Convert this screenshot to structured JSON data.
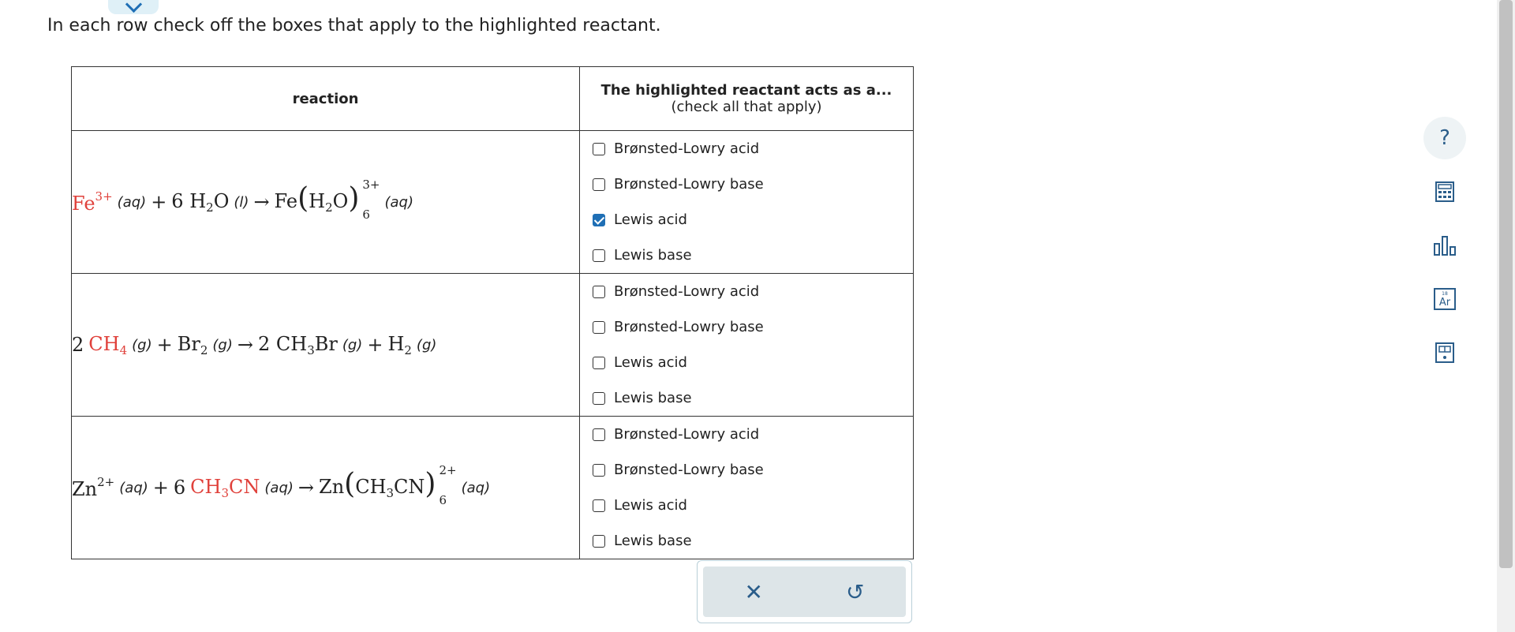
{
  "instruction": "In each row check off the boxes that apply to the highlighted reactant.",
  "table": {
    "col_reaction": "reaction",
    "col_role_title": "The highlighted reactant acts as a...",
    "col_role_subtitle": "(check all that apply)"
  },
  "rows": [
    {
      "equation": {
        "r1_symbol": "Fe",
        "r1_charge": "3+",
        "r1_state": "(aq)",
        "plus": "+",
        "coef": "6",
        "r2_a": "H",
        "r2_sub": "2",
        "r2_b": "O",
        "r2_state": "(l)",
        "arrow": "→",
        "p_metal": "Fe",
        "p_lparen": "(",
        "p_a": "H",
        "p_sub": "2",
        "p_b": "O",
        "p_rparen": ")",
        "p_charge": "3+",
        "p_count": "6",
        "p_state": "(aq)"
      },
      "options": [
        {
          "label": "Brønsted-Lowry acid",
          "checked": false
        },
        {
          "label": "Brønsted-Lowry base",
          "checked": false
        },
        {
          "label": "Lewis acid",
          "checked": true
        },
        {
          "label": "Lewis base",
          "checked": false
        }
      ]
    },
    {
      "equation": {
        "coef1": "2",
        "r1_a": "CH",
        "r1_sub": "4",
        "r1_state": "(g)",
        "plus1": "+",
        "r2_a": "Br",
        "r2_sub": "2",
        "r2_state": "(g)",
        "arrow": "→",
        "coef2": "2",
        "p1_a": "CH",
        "p1_sub": "3",
        "p1_b": "Br",
        "p1_state": "(g)",
        "plus2": "+",
        "p2_a": "H",
        "p2_sub": "2",
        "p2_state": "(g)"
      },
      "options": [
        {
          "label": "Brønsted-Lowry acid",
          "checked": false
        },
        {
          "label": "Brønsted-Lowry base",
          "checked": false
        },
        {
          "label": "Lewis acid",
          "checked": false
        },
        {
          "label": "Lewis base",
          "checked": false
        }
      ]
    },
    {
      "equation": {
        "r1_symbol": "Zn",
        "r1_charge": "2+",
        "r1_state": "(aq)",
        "plus": "+",
        "coef": "6",
        "r2_a": "CH",
        "r2_sub": "3",
        "r2_b": "CN",
        "r2_state": "(aq)",
        "arrow": "→",
        "p_metal": "Zn",
        "p_lparen": "(",
        "p_a": "CH",
        "p_sub": "3",
        "p_b": "CN",
        "p_rparen": ")",
        "p_charge": "2+",
        "p_count": "6",
        "p_state": "(aq)"
      },
      "options": [
        {
          "label": "Brønsted-Lowry acid",
          "checked": false
        },
        {
          "label": "Brønsted-Lowry base",
          "checked": false
        },
        {
          "label": "Lewis acid",
          "checked": false
        },
        {
          "label": "Lewis base",
          "checked": false
        }
      ]
    }
  ],
  "actions": {
    "clear_symbol": "✕",
    "undo_symbol": "↺"
  },
  "tools": {
    "help_symbol": "?",
    "items": [
      "help-icon",
      "calculator-icon",
      "bar-chart-icon",
      "periodic-table-icon",
      "data-card-icon"
    ],
    "ptable_number": "18",
    "ptable_symbol": "Ar"
  },
  "colors": {
    "accent": "#1f6fb5",
    "highlight": "#e0413b",
    "action_bar": "#dde5e8"
  }
}
